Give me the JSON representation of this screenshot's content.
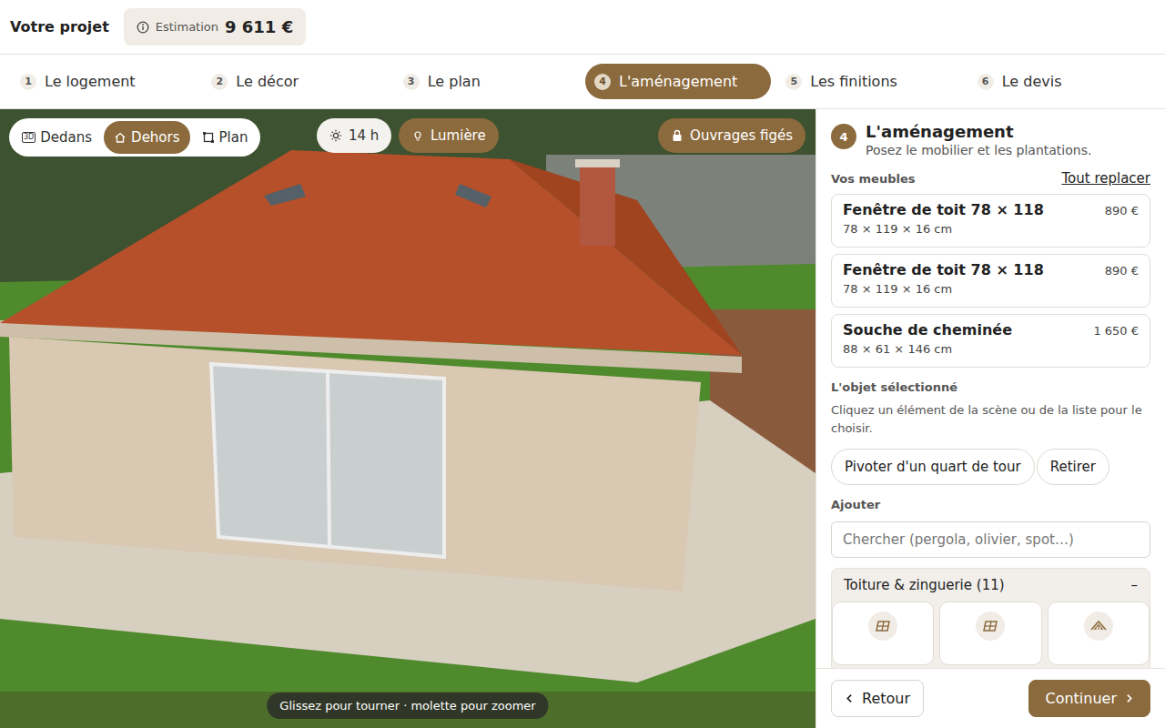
{
  "header": {
    "project_label": "Votre projet",
    "estimate_label": "Estimation",
    "estimate_value": "9 611 €"
  },
  "steps": [
    {
      "number": "1",
      "label": "Le logement",
      "selected": false
    },
    {
      "number": "2",
      "label": "Le décor",
      "selected": false
    },
    {
      "number": "3",
      "label": "Le plan",
      "selected": false
    },
    {
      "number": "4",
      "label": "L'aménagement",
      "selected": true
    },
    {
      "number": "5",
      "label": "Les finitions",
      "selected": false
    },
    {
      "number": "6",
      "label": "Le devis",
      "selected": false
    }
  ],
  "scene": {
    "modes": [
      {
        "label": "Dedans",
        "icon_text": "3D",
        "selected": false
      },
      {
        "label": "Dehors",
        "selected": true
      },
      {
        "label": "Plan",
        "selected": false
      }
    ],
    "time": "14 h",
    "light": {
      "label": "Lumière",
      "on": true
    },
    "lock": {
      "label": "Ouvrages figés",
      "on": true
    },
    "hint": "Glissez pour tourner · molette pour zoomer"
  },
  "panel": {
    "step_number": "4",
    "title": "L'aménagement",
    "subtitle": "Posez le mobilier et les plantations.",
    "furniture_heading": "Vos meubles",
    "replace_link": "Tout replacer",
    "furniture": [
      {
        "name": "Fenêtre de toit 78 × 118",
        "dims": "78 × 119 × 16 cm",
        "price": "890 €"
      },
      {
        "name": "Fenêtre de toit 78 × 118",
        "dims": "78 × 119 × 16 cm",
        "price": "890 €"
      },
      {
        "name": "Souche de cheminée",
        "dims": "88 × 61 × 146 cm",
        "price": "1 650 €"
      }
    ],
    "selected_heading": "L'objet sélectionné",
    "selected_help": "Cliquez un élément de la scène ou de la liste pour le choisir.",
    "actions": [
      "Pivoter d'un quart de tour",
      "Retirer"
    ],
    "add_heading": "Ajouter",
    "search_placeholder": "Chercher (pergola, olivier, spot…)",
    "category": {
      "label": "Toiture & zinguerie (11)",
      "toggle": "–",
      "expanded": true,
      "tiles": [
        {
          "kind": "window"
        },
        {
          "kind": "window"
        },
        {
          "kind": "roof"
        }
      ]
    },
    "back": "Retour",
    "next": "Continuer"
  }
}
